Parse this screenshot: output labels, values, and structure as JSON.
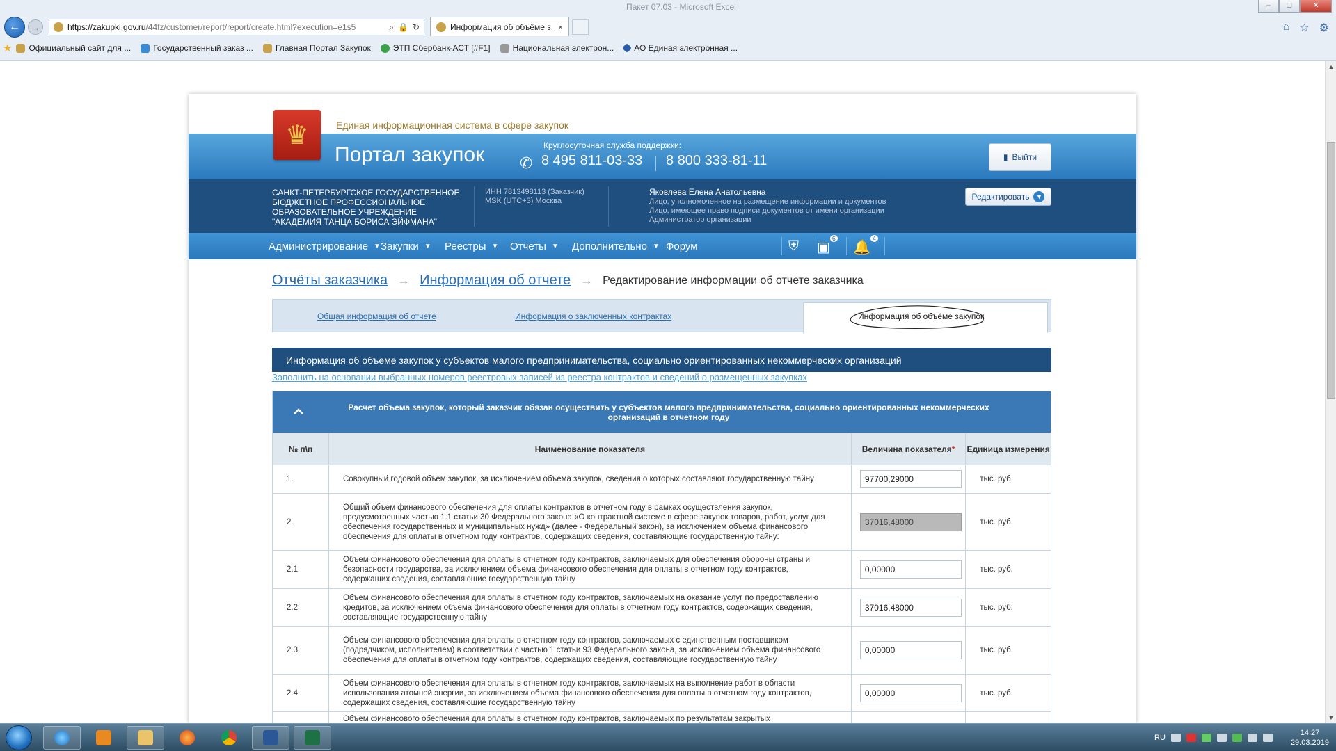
{
  "browser": {
    "window_title": "Пакет 07.03 - Microsoft Excel",
    "url_host": "https://zakupki.gov.ru",
    "url_path": "/44fz/customer/report/report/create.html?execution=e1s5",
    "tab_title": "Информация об объёме з...",
    "tab_close": "×",
    "favorites": [
      {
        "label": "Официальный сайт для ..."
      },
      {
        "label": "Государственный заказ ..."
      },
      {
        "label": "Главная Портал Закупок"
      },
      {
        "label": "ЭТП Сбербанк-АСТ [#F1]"
      },
      {
        "label": "Национальная электрон..."
      },
      {
        "label": "АО Единая электронная ..."
      }
    ]
  },
  "header": {
    "eis_title": "Единая информационная система в сфере закупок",
    "portal_title": "Портал закупок",
    "support_label": "Круглосуточная служба поддержки:",
    "phone1": "8 495 811-03-33",
    "phone2": "8 800 333-81-11",
    "logout_label": "Выйти"
  },
  "org": {
    "name": "САНКТ-ПЕТЕРБУРГСКОЕ ГОСУДАРСТВЕННОЕ БЮДЖЕТНОЕ ПРОФЕССИОНАЛЬНОЕ ОБРАЗОВАТЕЛЬНОЕ УЧРЕЖДЕНИЕ \"АКАДЕМИЯ ТАНЦА БОРИСА ЭЙФМАНА\"",
    "inn": "ИНН 7813498113 (Заказчик)",
    "timezone": "MSK (UTC+3) Москва",
    "user_name": "Яковлева Елена Анатольевна",
    "role1": "Лицо, уполномоченное на размещение информации и документов",
    "role2": "Лицо, имеющее право подписи документов от имени организации",
    "role3": "Администратор организации",
    "edit_label": "Редактировать"
  },
  "menu": {
    "items": [
      {
        "label": "Администрирование"
      },
      {
        "label": "Закупки"
      },
      {
        "label": "Реестры"
      },
      {
        "label": "Отчеты"
      },
      {
        "label": "Дополнительно"
      },
      {
        "label": "Форум"
      }
    ],
    "calendar_count": "6",
    "bell_count": "4"
  },
  "breadcrumb": {
    "b1": "Отчёты заказчика",
    "b2": "Информация об отчете",
    "current": "Редактирование информации об отчете заказчика"
  },
  "tabs": {
    "t1": "Общая информация об отчете",
    "t2": "Информация о заключенных контрактах",
    "t3": "Информация об объёме закупок"
  },
  "section": {
    "title": "Информация об объеме закупок у субъектов малого предпринимательства, социально ориентированных некоммерческих организаций",
    "fill_link": "Заполнить на основании выбранных номеров реестровых записей из реестра контрактов и сведений о размещенных закупках"
  },
  "table": {
    "caption": "Расчет объема закупок, который заказчик обязан осуществить у субъектов малого предпринимательства, социально ориентированных некоммерческих организаций в отчетном году",
    "h_num": "№ п\\п",
    "h_name": "Наименование показателя",
    "h_value": "Величина показателя",
    "h_req": "*",
    "h_unit": "Единица измерения",
    "rows": [
      {
        "num": "1.",
        "name": "Совокупный годовой объем закупок, за исключением объема закупок, сведения о которых составляют государственную тайну",
        "value": "97700,29000",
        "unit": "тыс. руб."
      },
      {
        "num": "2.",
        "name": "Общий объем финансового обеспечения для оплаты контрактов в отчетном году в рамках осуществления закупок, предусмотренных частью 1.1 статьи 30 Федерального закона «О контрактной системе в сфере закупок товаров, работ, услуг для обеспечения государственных и муниципальных нужд» (далее - Федеральный закон), за исключением объема финансового обеспечения для оплаты в отчетном году контрактов, содержащих сведения, составляющие государственную тайну:",
        "value": "37016,48000",
        "unit": "тыс. руб."
      },
      {
        "num": "2.1",
        "name": "Объем финансового обеспечения для оплаты в отчетном году контрактов, заключаемых для обеспечения обороны страны и безопасности государства, за исключением объема финансового обеспечения для оплаты в отчетном году контрактов, содержащих сведения, составляющие государственную тайну",
        "value": "0,00000",
        "unit": "тыс. руб."
      },
      {
        "num": "2.2",
        "name": "Объем финансового обеспечения для оплаты в отчетном году контрактов, заключаемых на оказание услуг по предоставлению кредитов, за исключением объема финансового обеспечения для оплаты в отчетном году контрактов, содержащих сведения, составляющие государственную тайну",
        "value": "37016,48000",
        "unit": "тыс. руб."
      },
      {
        "num": "2.3",
        "name": "Объем финансового обеспечения для оплаты в отчетном году контрактов, заключаемых с единственным поставщиком (подрядчиком, исполнителем) в соответствии с частью 1 статьи 93 Федерального закона, за исключением объема финансового обеспечения для оплаты в отчетном году контрактов, содержащих сведения, составляющие государственную тайну",
        "value": "0,00000",
        "unit": "тыс. руб."
      },
      {
        "num": "2.4",
        "name": "Объем финансового обеспечения для оплаты в отчетном году контрактов, заключаемых на выполнение работ в области использования атомной энергии, за исключением объема финансового обеспечения для оплаты в отчетном году контрактов, содержащих сведения, составляющие государственную тайну",
        "value": "0,00000",
        "unit": "тыс. руб."
      },
      {
        "num": "",
        "name": "Объем финансового обеспечения для оплаты в отчетном году контрактов, заключаемых по результатам закрытых",
        "value": "",
        "unit": ""
      }
    ]
  },
  "taskbar": {
    "lang": "RU",
    "time": "14:27",
    "date": "29.03.2019"
  }
}
